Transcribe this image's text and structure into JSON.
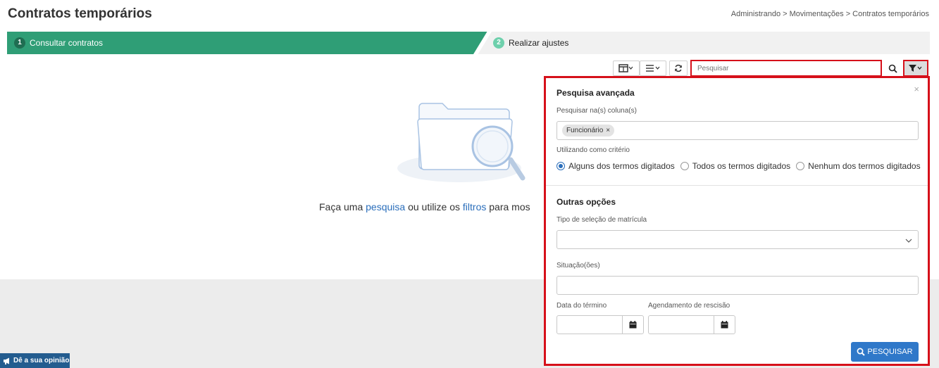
{
  "page": {
    "title": "Contratos temporários",
    "breadcrumb": "Administrando > Movimentações > Contratos temporários"
  },
  "steps": [
    {
      "number": "1",
      "label": "Consultar contratos",
      "active": true
    },
    {
      "number": "2",
      "label": "Realizar ajustes",
      "active": false
    }
  ],
  "toolbar": {
    "columns_icon": "columns-icon",
    "list_icon": "list-icon",
    "refresh_icon": "refresh-icon",
    "search_placeholder": "Pesquisar",
    "search_icon": "search-icon",
    "filter_icon": "filter-icon"
  },
  "empty_state": {
    "text_before": "Faça uma ",
    "link_search": "pesquisa",
    "text_middle": " ou utilize os ",
    "link_filters": "filtros",
    "text_after": " para mos"
  },
  "advanced_search": {
    "title": "Pesquisa avançada",
    "close": "×",
    "columns_label": "Pesquisar na(s) coluna(s)",
    "selected_columns": [
      "Funcionário"
    ],
    "criteria_label": "Utilizando como critério",
    "criteria_options": [
      {
        "label": "Alguns dos termos digitados",
        "selected": true
      },
      {
        "label": "Todos os termos digitados",
        "selected": false
      },
      {
        "label": "Nenhum dos termos digitados",
        "selected": false
      }
    ]
  },
  "other_options": {
    "title": "Outras opções",
    "registration_type_label": "Tipo de seleção de matrícula",
    "registration_type_value": "",
    "status_label": "Situação(ões)",
    "status_value": "",
    "end_date_label": "Data do término",
    "end_date_value": "",
    "termination_schedule_label": "Agendamento de rescisão",
    "termination_schedule_value": "",
    "submit_label": "PESQUISAR"
  },
  "feedback": {
    "label": "Dê a sua opinião"
  },
  "colors": {
    "step_active": "#2f9e76",
    "highlight": "#d6101a",
    "primary_button": "#2f78c9",
    "link": "#2a6ebb"
  }
}
